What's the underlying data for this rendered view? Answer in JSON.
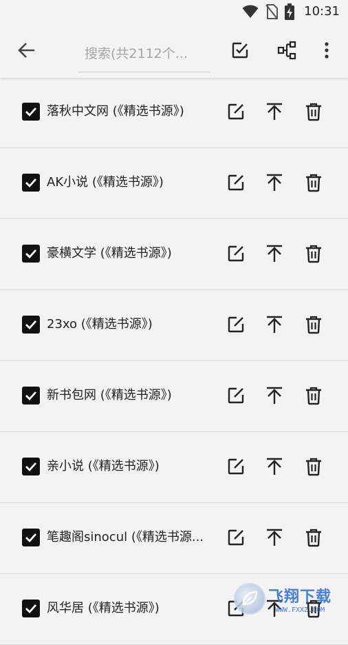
{
  "status_bar": {
    "time": "10:31",
    "icons": [
      "wifi-icon",
      "no-sim-icon",
      "battery-charging-icon"
    ]
  },
  "toolbar": {
    "back_icon": "arrow-left-icon",
    "search_placeholder": "搜索(共2112个...",
    "select_all_icon": "checkbox-edit-icon",
    "group_icon": "group-tree-icon",
    "more_icon": "more-vertical-icon"
  },
  "sources": [
    {
      "label": "落秋中文网 (《精选书源》)",
      "checked": true
    },
    {
      "label": "AK小说 (《精选书源》)",
      "checked": true
    },
    {
      "label": "豪横文学 (《精选书源》)",
      "checked": true
    },
    {
      "label": "23xo (《精选书源》)",
      "checked": true
    },
    {
      "label": "新书包网 (《精选书源》)",
      "checked": true
    },
    {
      "label": "亲小说 (《精选书源》)",
      "checked": true
    },
    {
      "label": "笔趣阁sinocul (《精选书源...",
      "checked": true
    },
    {
      "label": "风华居 (《精选书源》)",
      "checked": true
    }
  ],
  "row_actions": {
    "edit_icon": "edit-icon",
    "top_icon": "move-to-top-icon",
    "delete_icon": "trash-icon"
  },
  "watermark": {
    "text": "飞翔下载",
    "url": "WWW.FXXZ.COM"
  }
}
